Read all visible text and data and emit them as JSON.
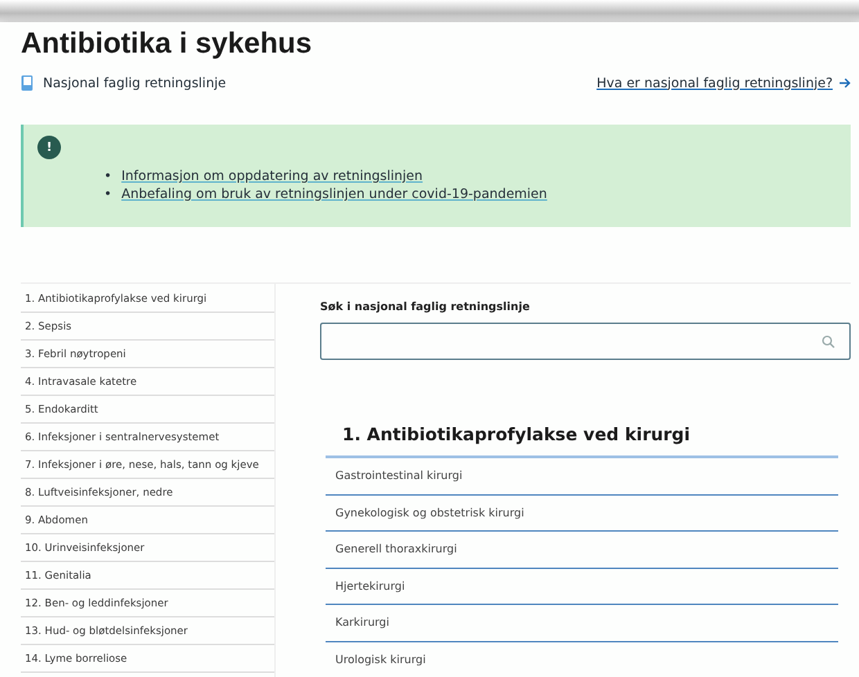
{
  "title": "Antibiotika i sykehus",
  "subtitle": {
    "label": "Nasjonal faglig retningslinje",
    "link": "Hva er nasjonal faglig retningslinje?"
  },
  "alert": {
    "icon": "!",
    "bullet": "•",
    "links": [
      "Informasjon om oppdatering av retningslinjen",
      "Anbefaling om bruk av retningslinjen under covid-19-pandemien"
    ]
  },
  "sidebar": {
    "items": [
      {
        "label": "1. Antibiotikaprofylakse ved kirurgi"
      },
      {
        "label": "2. Sepsis"
      },
      {
        "label": "3. Febril nøytropeni"
      },
      {
        "label": "4. Intravasale katetre"
      },
      {
        "label": "5. Endokarditt"
      },
      {
        "label": "6. Infeksjoner i sentralnervesystemet"
      },
      {
        "label": "7. Infeksjoner i øre, nese, hals, tann og kjeve"
      },
      {
        "label": "8. Luftveisinfeksjoner, nedre"
      },
      {
        "label": "9. Abdomen"
      },
      {
        "label": "10. Urinveisinfeksjoner"
      },
      {
        "label": "11. Genitalia"
      },
      {
        "label": "12. Ben- og leddinfeksjoner"
      },
      {
        "label": "13. Hud- og bløtdelsinfeksjoner"
      },
      {
        "label": "14. Lyme borreliose"
      }
    ]
  },
  "search": {
    "label": "Søk i nasjonal faglig retningslinje"
  },
  "section": {
    "heading": "1. Antibiotikaprofylakse ved kirurgi",
    "items": [
      "Gastrointestinal kirurgi",
      "Gynekologisk og obstetrisk kirurgi",
      "Generell thoraxkirurgi",
      "Hjertekirurgi",
      "Karkirurgi",
      "Urologisk kirurgi"
    ]
  }
}
